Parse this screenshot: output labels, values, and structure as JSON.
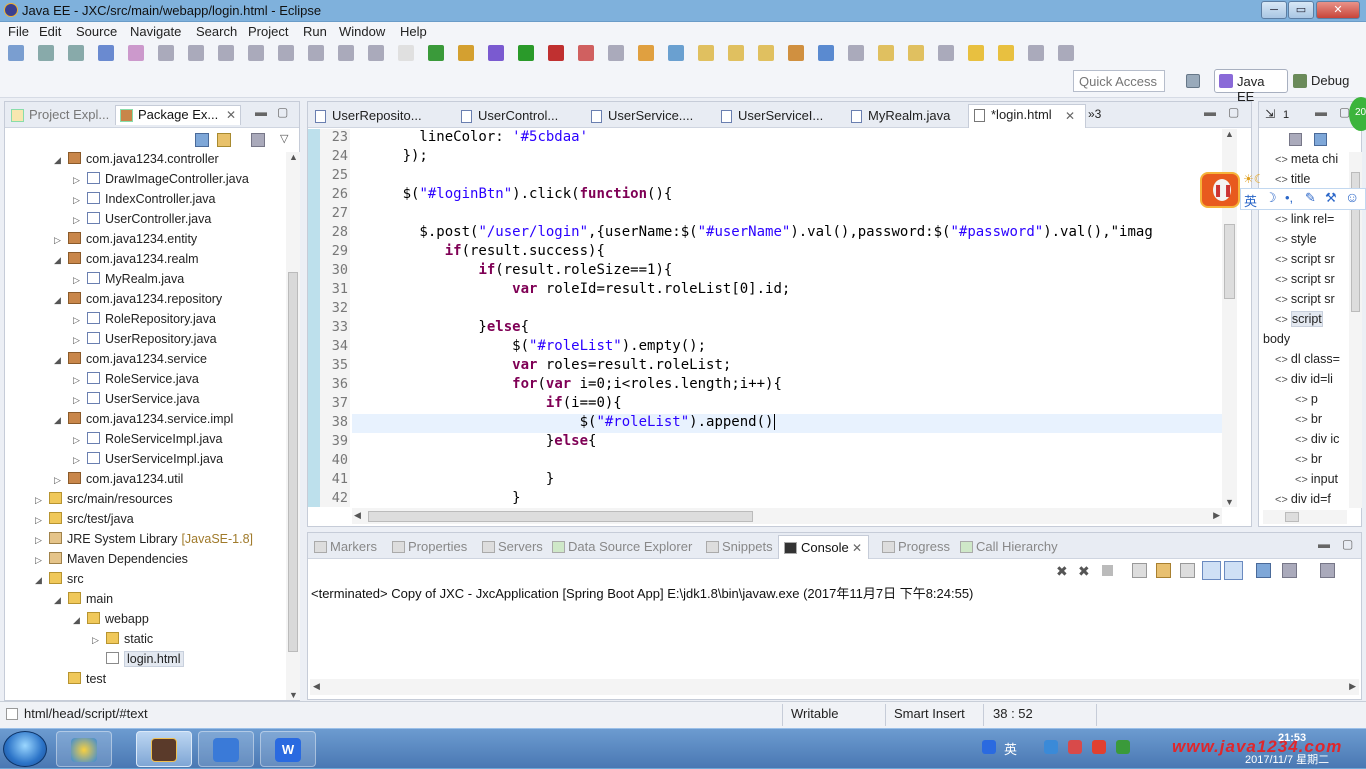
{
  "window": {
    "title": "Java EE - JXC/src/main/webapp/login.html - Eclipse",
    "min_label": "─",
    "max_label": "▭",
    "close_label": "✕"
  },
  "menu": [
    "File",
    "Edit",
    "Source",
    "Navigate",
    "Search",
    "Project",
    "Run",
    "Window",
    "Help"
  ],
  "perspectives": {
    "quick_access_placeholder": "Quick Access",
    "java_ee": "Java EE",
    "debug": "Debug"
  },
  "left_view": {
    "tabs": [
      {
        "label": "Project Expl..."
      },
      {
        "label": "Package Ex..."
      }
    ],
    "tree": [
      {
        "label": "com.java1234.controller",
        "type": "pkg",
        "indent": 1,
        "tw": "◢"
      },
      {
        "label": "DrawImageController.java",
        "type": "java",
        "indent": 2,
        "tw": "▷"
      },
      {
        "label": "IndexController.java",
        "type": "java",
        "indent": 2,
        "tw": "▷"
      },
      {
        "label": "UserController.java",
        "type": "java",
        "indent": 2,
        "tw": "▷"
      },
      {
        "label": "com.java1234.entity",
        "type": "pkg",
        "indent": 1,
        "tw": "▷"
      },
      {
        "label": "com.java1234.realm",
        "type": "pkg",
        "indent": 1,
        "tw": "◢"
      },
      {
        "label": "MyRealm.java",
        "type": "java",
        "indent": 2,
        "tw": "▷"
      },
      {
        "label": "com.java1234.repository",
        "type": "pkg",
        "indent": 1,
        "tw": "◢"
      },
      {
        "label": "RoleRepository.java",
        "type": "java",
        "indent": 2,
        "tw": "▷"
      },
      {
        "label": "UserRepository.java",
        "type": "java",
        "indent": 2,
        "tw": "▷"
      },
      {
        "label": "com.java1234.service",
        "type": "pkg",
        "indent": 1,
        "tw": "◢"
      },
      {
        "label": "RoleService.java",
        "type": "java",
        "indent": 2,
        "tw": "▷"
      },
      {
        "label": "UserService.java",
        "type": "java",
        "indent": 2,
        "tw": "▷"
      },
      {
        "label": "com.java1234.service.impl",
        "type": "pkg",
        "indent": 1,
        "tw": "◢"
      },
      {
        "label": "RoleServiceImpl.java",
        "type": "java",
        "indent": 2,
        "tw": "▷"
      },
      {
        "label": "UserServiceImpl.java",
        "type": "java",
        "indent": 2,
        "tw": "▷"
      },
      {
        "label": "com.java1234.util",
        "type": "pkg",
        "indent": 1,
        "tw": "▷"
      },
      {
        "label": "src/main/resources",
        "type": "folder",
        "indent": 0,
        "tw": "▷"
      },
      {
        "label": "src/test/java",
        "type": "folder",
        "indent": 0,
        "tw": "▷"
      },
      {
        "label": "JRE System Library",
        "suffix": "[JavaSE-1.8]",
        "type": "lib",
        "indent": 0,
        "tw": "▷"
      },
      {
        "label": "Maven Dependencies",
        "type": "lib",
        "indent": 0,
        "tw": "▷"
      },
      {
        "label": "src",
        "type": "folder",
        "indent": 0,
        "tw": "◢"
      },
      {
        "label": "main",
        "type": "folder",
        "indent": 1,
        "tw": "◢"
      },
      {
        "label": "webapp",
        "type": "folder",
        "indent": 2,
        "tw": "◢"
      },
      {
        "label": "static",
        "type": "folder",
        "indent": 3,
        "tw": "▷"
      },
      {
        "label": "login.html",
        "type": "html",
        "indent": 3,
        "tw": "",
        "selected": true
      },
      {
        "label": "test",
        "type": "folder",
        "indent": 1,
        "tw": ""
      }
    ]
  },
  "editor": {
    "tabs": [
      {
        "label": "UserReposito..."
      },
      {
        "label": "UserControl..."
      },
      {
        "label": "UserService...."
      },
      {
        "label": "UserServiceI..."
      },
      {
        "label": "MyRealm.java"
      },
      {
        "label": "*login.html",
        "active": true
      }
    ],
    "overflow_tabs": "»3",
    "line_numbers": [
      "23",
      "24",
      "25",
      "26",
      "27",
      "28",
      "29",
      "30",
      "31",
      "32",
      "33",
      "34",
      "35",
      "36",
      "37",
      "38",
      "39",
      "40",
      "41",
      "42"
    ],
    "current_line": "38",
    "code": [
      [
        [
          "t",
          "        lineColor: "
        ],
        [
          "s",
          "'#5cbdaa'"
        ]
      ],
      [
        [
          "t",
          "      });"
        ]
      ],
      [
        [
          "t",
          ""
        ]
      ],
      [
        [
          "t",
          "      $("
        ],
        [
          "s",
          "\"#loginBtn\""
        ],
        [
          "t",
          ").click("
        ],
        [
          "k",
          "function"
        ],
        [
          "t",
          "(){"
        ]
      ],
      [
        [
          "t",
          ""
        ]
      ],
      [
        [
          "t",
          "        $.post("
        ],
        [
          "s",
          "\"/user/login\""
        ],
        [
          "t",
          ",{userName:$("
        ],
        [
          "s",
          "\"#userName\""
        ],
        [
          "t",
          ").val(),password:$("
        ],
        [
          "s",
          "\"#password\""
        ],
        [
          "t",
          ").val(),\"imag"
        ]
      ],
      [
        [
          "t",
          "           "
        ],
        [
          "k",
          "if"
        ],
        [
          "t",
          "(result.success){"
        ]
      ],
      [
        [
          "t",
          "               "
        ],
        [
          "k",
          "if"
        ],
        [
          "t",
          "(result.roleSize==1){"
        ]
      ],
      [
        [
          "t",
          "                   "
        ],
        [
          "k",
          "var"
        ],
        [
          "t",
          " roleId=result.roleList[0].id;"
        ]
      ],
      [
        [
          "t",
          ""
        ]
      ],
      [
        [
          "t",
          "               }"
        ],
        [
          "k",
          "else"
        ],
        [
          "t",
          "{"
        ]
      ],
      [
        [
          "t",
          "                   $("
        ],
        [
          "s",
          "\"#roleList\""
        ],
        [
          "t",
          ").empty();"
        ]
      ],
      [
        [
          "t",
          "                   "
        ],
        [
          "k",
          "var"
        ],
        [
          "t",
          " roles=result.roleList;"
        ]
      ],
      [
        [
          "t",
          "                   "
        ],
        [
          "k",
          "for"
        ],
        [
          "t",
          "("
        ],
        [
          "k",
          "var"
        ],
        [
          "t",
          " i=0;i<roles.length;i++){"
        ]
      ],
      [
        [
          "t",
          "                       "
        ],
        [
          "k",
          "if"
        ],
        [
          "t",
          "(i==0){"
        ]
      ],
      [
        [
          "t",
          "                           $("
        ],
        [
          "s",
          "\"#roleList\""
        ],
        [
          "t",
          ").append()"
        ]
      ],
      [
        [
          "t",
          "                       }"
        ],
        [
          "k",
          "else"
        ],
        [
          "t",
          "{"
        ]
      ],
      [
        [
          "t",
          ""
        ]
      ],
      [
        [
          "t",
          "                       }"
        ]
      ],
      [
        [
          "t",
          "                   }"
        ]
      ]
    ]
  },
  "outline": {
    "tab": "1",
    "items": [
      {
        "label": "meta chi",
        "indent": 1
      },
      {
        "label": "title",
        "indent": 1
      },
      {
        "label": "",
        "indent": 1
      },
      {
        "label": "link rel=",
        "indent": 1
      },
      {
        "label": "style",
        "indent": 1
      },
      {
        "label": "script sr",
        "indent": 1
      },
      {
        "label": "script sr",
        "indent": 1
      },
      {
        "label": "script sr",
        "indent": 1
      },
      {
        "label": "script",
        "indent": 1,
        "selected": true
      },
      {
        "label": "body",
        "indent": 0
      },
      {
        "label": "dl class=",
        "indent": 1
      },
      {
        "label": "div id=li",
        "indent": 1
      },
      {
        "label": "p",
        "indent": 2
      },
      {
        "label": "br",
        "indent": 2
      },
      {
        "label": "div ic",
        "indent": 2
      },
      {
        "label": "br",
        "indent": 2
      },
      {
        "label": "input",
        "indent": 2
      },
      {
        "label": "div id=f",
        "indent": 1
      }
    ]
  },
  "console": {
    "tabs": [
      "Markers",
      "Properties",
      "Servers",
      "Data Source Explorer",
      "Snippets",
      "Console",
      "Progress",
      "Call Hierarchy"
    ],
    "active_tab": "Console",
    "terminated": "<terminated> Copy of JXC - JxcApplication [Spring Boot App] E:\\jdk1.8\\bin\\javaw.exe (2017年11月7日 下午8:24:55)"
  },
  "status": {
    "path": "html/head/script/#text",
    "writable": "Writable",
    "insert_mode": "Smart Insert",
    "position": "38 : 52"
  },
  "ime": {
    "lang": "英"
  },
  "green_badge": "20",
  "taskbar": {
    "time": "21:53",
    "date": "2017/11/7 星期二",
    "watermark": "www.java1234.com",
    "ime_lang": "英"
  }
}
